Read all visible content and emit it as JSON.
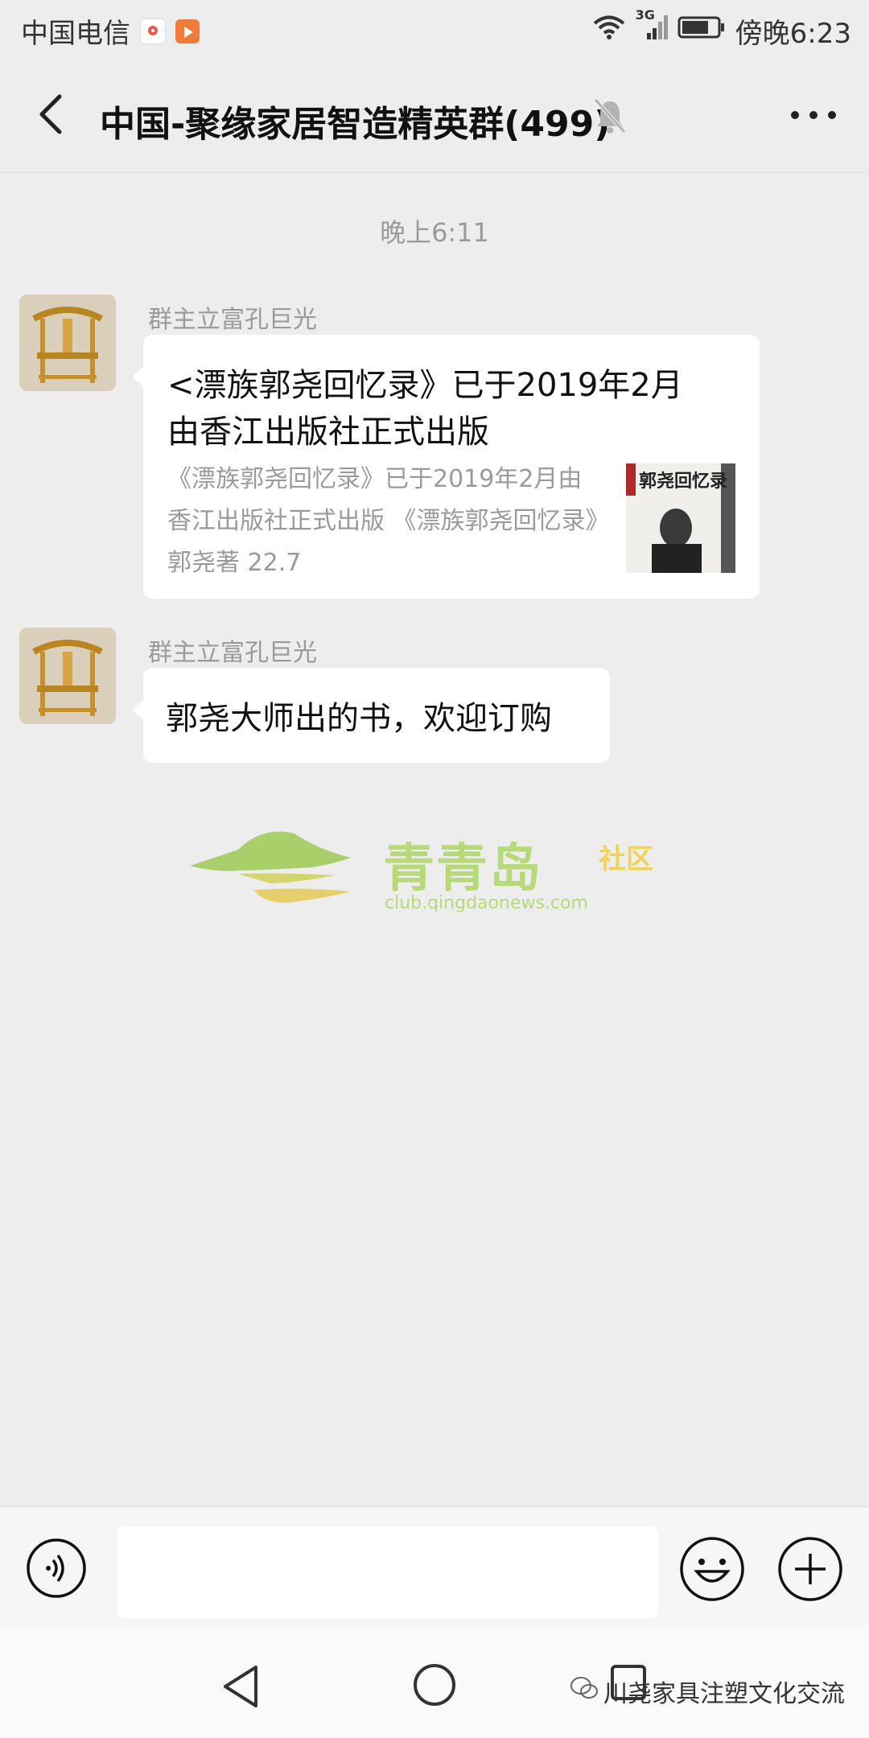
{
  "status_bar": {
    "carrier": "中国电信",
    "network": "3G",
    "time": "傍晚6:23"
  },
  "header": {
    "title": "中国-聚缘家居智造精英群(499)",
    "icons": [
      "back-arrow-icon",
      "mute-bell-icon",
      "more-icon"
    ]
  },
  "chat": {
    "time_label": "晚上6:11",
    "messages": [
      {
        "sender": "群主立富孔巨光",
        "type": "link",
        "title": "<漂族郭尧回忆录》已于2019年2月由香江出版社正式出版",
        "description": "《漂族郭尧回忆录》已于2019年2月由香江出版社正式出版          《漂族郭尧回忆录》郭尧著 22.7",
        "thumb_text": "郭尧回忆录"
      },
      {
        "sender": "群主立富孔巨光",
        "type": "text",
        "text": "郭尧大师出的书，欢迎订购"
      }
    ]
  },
  "watermark": {
    "name": "青青岛",
    "tag": "社区",
    "url": "club.qingdaonews.com"
  },
  "input_bar": {
    "placeholder": "",
    "icons": [
      "voice-icon",
      "emoji-icon",
      "plus-icon"
    ]
  },
  "bottom_watermark": "川尧家具注塑文化交流",
  "colors": {
    "background": "#ededed",
    "bubble": "#ffffff",
    "gray_text": "#9a9a9a",
    "logo_green": "#a9cf6a"
  }
}
